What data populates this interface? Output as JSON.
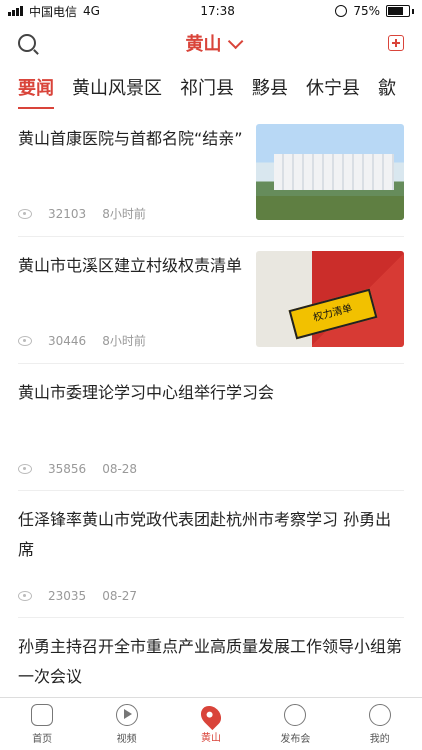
{
  "status": {
    "carrier": "中国电信",
    "network": "4G",
    "time": "17:38",
    "battery": "75%"
  },
  "header": {
    "city": "黄山"
  },
  "tabs": [
    "要闻",
    "黄山风景区",
    "祁门县",
    "黟县",
    "休宁县",
    "歙"
  ],
  "news": [
    {
      "title": "黄山首康医院与首都名院“结亲”",
      "views": "32103",
      "time": "8小时前",
      "image": "hospital"
    },
    {
      "title": "黄山市屯溪区建立村级权责清单",
      "views": "30446",
      "time": "8小时前",
      "image": "power-list"
    },
    {
      "title": "黄山市委理论学习中心组举行学习会",
      "views": "35856",
      "time": "08-28"
    },
    {
      "title": "任泽锋率黄山市党政代表团赴杭州市考察学习 孙勇出席",
      "views": "23035",
      "time": "08-27"
    },
    {
      "title": "孙勇主持召开全市重点产业高质量发展工作领导小组第一次会议"
    }
  ],
  "bottom": [
    "首页",
    "视频",
    "黄山",
    "发布会",
    "我的"
  ]
}
